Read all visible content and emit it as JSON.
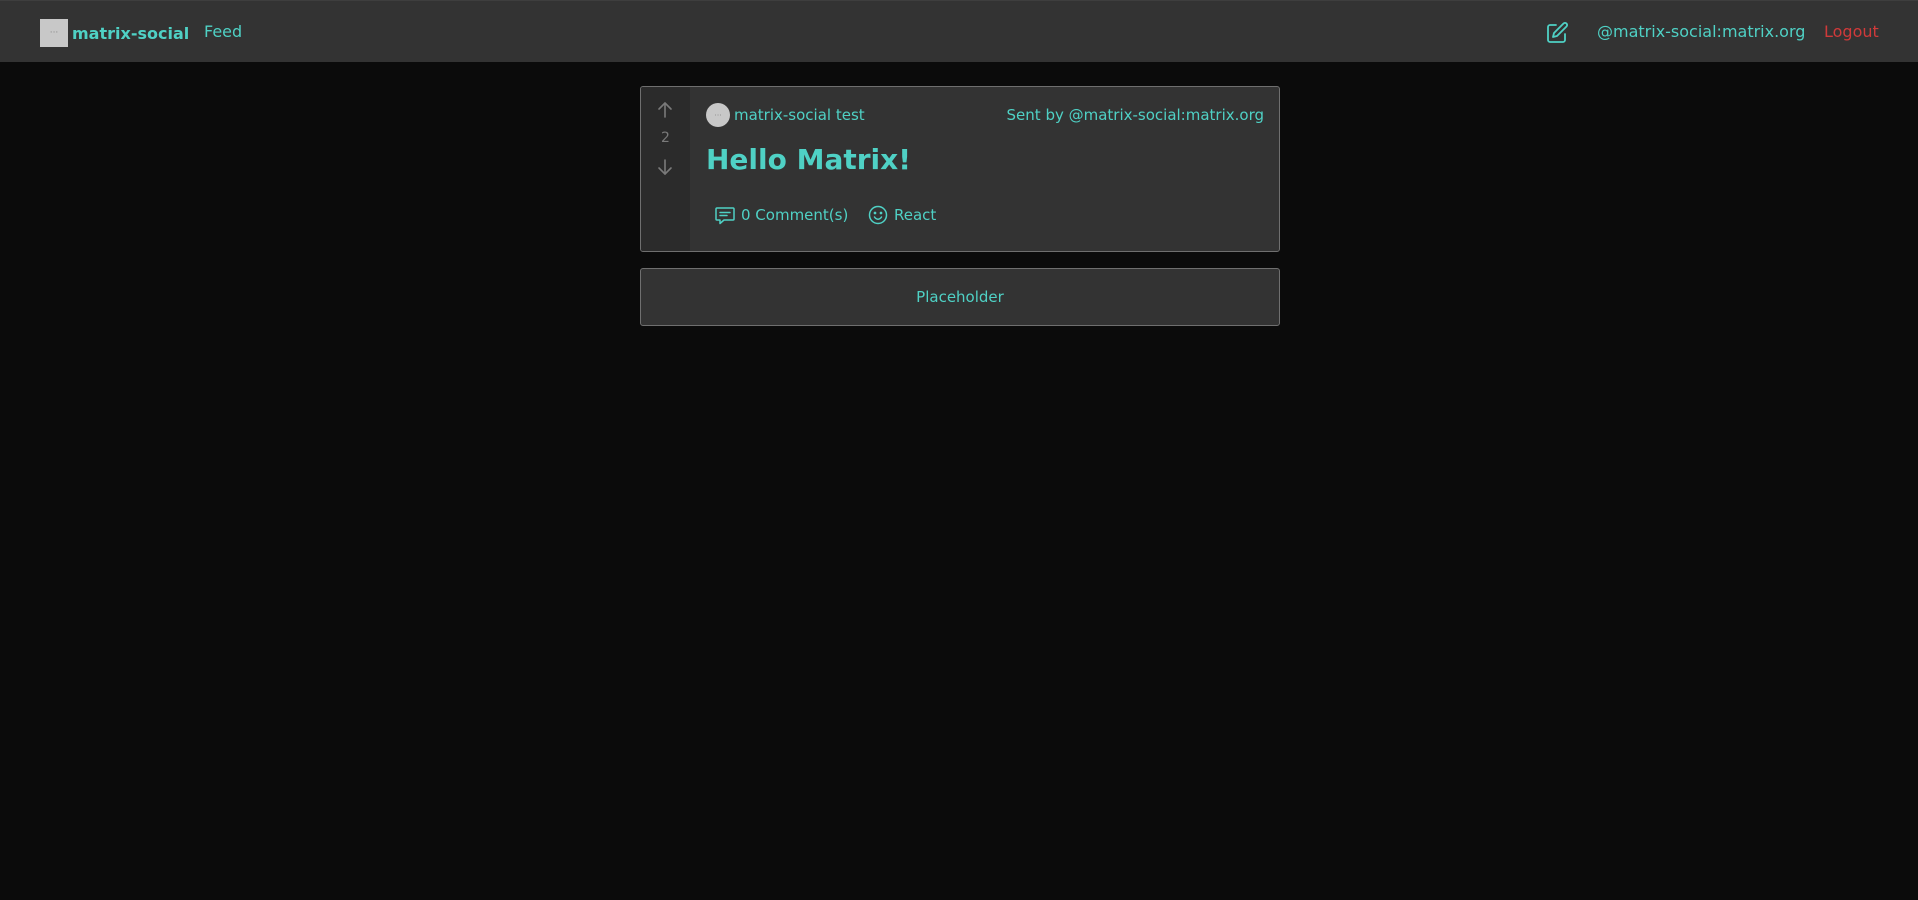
{
  "navbar": {
    "brand_name": "matrix-social",
    "feed_label": "Feed",
    "user_id": "@matrix-social:matrix.org",
    "logout_label": "Logout",
    "compose_icon": "pencil-square-icon"
  },
  "post": {
    "vote_count": "2",
    "author_name": "matrix-social test",
    "sender": "Sent by @matrix-social:matrix.org",
    "title": "Hello Matrix!",
    "comments_label": "0 Comment(s)",
    "react_label": "React"
  },
  "placeholder": {
    "label": "Placeholder"
  },
  "colors": {
    "accent": "#4fd1c5",
    "danger": "#d03a3a",
    "navbar_bg": "#333333",
    "page_bg": "#0b0b0b",
    "card_bg": "#333333"
  }
}
